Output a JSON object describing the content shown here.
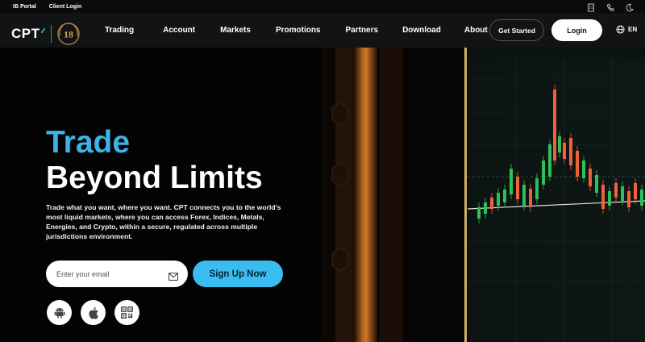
{
  "topbar": {
    "ib_portal": "IB Portal",
    "client_login": "Client Login",
    "icons": [
      "building-icon",
      "phone-icon",
      "moon-icon"
    ]
  },
  "nav": {
    "logo_text": "CPT",
    "badge_number": "18",
    "items": [
      "Trading",
      "Account",
      "Markets",
      "Promotions",
      "Partners",
      "Download",
      "About"
    ],
    "get_started": "Get Started",
    "login": "Login",
    "language": "EN"
  },
  "hero": {
    "headline_accent": "Trade",
    "headline_main": "Beyond Limits",
    "subtext": "Trade what you want, where you want. CPT connects you to the world's most liquid markets, where you can access Forex, Indices, Metals, Energies, and Crypto, within a secure, regulated across multiple jurisdictions environment.",
    "email_placeholder": "Enter your email",
    "signup": "Sign Up Now",
    "app_icons": [
      "android-icon",
      "apple-icon",
      "qr-code-icon"
    ]
  },
  "colors": {
    "accent": "#3bb4e8",
    "signup_button": "#3bbcf0",
    "nav_bg": "#121314",
    "candle_up": "#2fbf5a",
    "candle_down": "#f0603c"
  }
}
